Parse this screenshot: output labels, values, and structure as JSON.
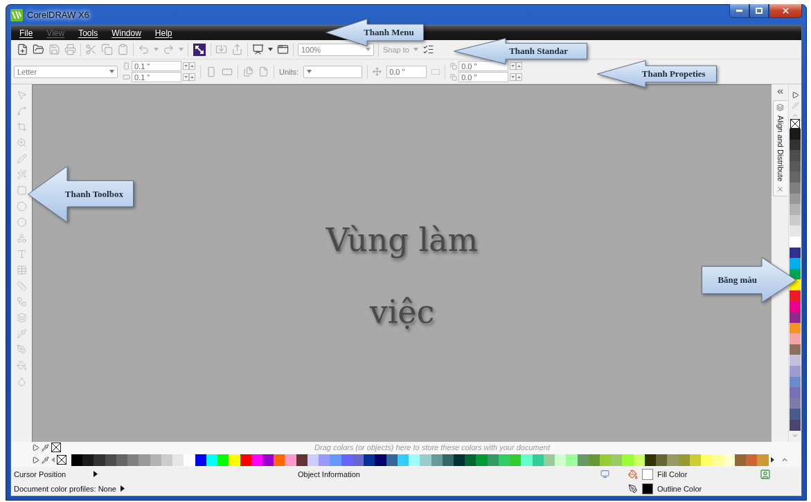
{
  "window": {
    "title": "CorelDRAW X6"
  },
  "menu": [
    {
      "label": "File",
      "disabled": false
    },
    {
      "label": "View",
      "disabled": true
    },
    {
      "label": "Tools",
      "disabled": false
    },
    {
      "label": "Window",
      "disabled": false
    },
    {
      "label": "Help",
      "disabled": false
    }
  ],
  "standard_toolbar": {
    "buttons": [
      {
        "kind": "new",
        "disabled": false
      },
      {
        "kind": "open",
        "disabled": false
      },
      {
        "kind": "save",
        "disabled": true
      },
      {
        "kind": "print",
        "disabled": true
      },
      {
        "kind": "separator"
      },
      {
        "kind": "cut",
        "disabled": true
      },
      {
        "kind": "copy",
        "disabled": true
      },
      {
        "kind": "paste",
        "disabled": true
      },
      {
        "kind": "separator"
      },
      {
        "kind": "undo",
        "disabled": true
      },
      {
        "kind": "caret",
        "disabled": true
      },
      {
        "kind": "redo",
        "disabled": true
      },
      {
        "kind": "caret",
        "disabled": true
      },
      {
        "kind": "separator"
      },
      {
        "kind": "launcher",
        "disabled": false
      },
      {
        "kind": "separator"
      },
      {
        "kind": "import",
        "disabled": true
      },
      {
        "kind": "export",
        "disabled": true
      },
      {
        "kind": "separator"
      },
      {
        "kind": "publish",
        "disabled": false
      },
      {
        "kind": "caret",
        "disabled": false
      },
      {
        "kind": "welcome",
        "disabled": false
      },
      {
        "kind": "separator"
      },
      {
        "kind": "zoom",
        "value": "100%",
        "disabled": true
      },
      {
        "kind": "separator"
      },
      {
        "kind": "snap",
        "label": "Snap to",
        "disabled": true
      },
      {
        "kind": "options",
        "disabled": false
      }
    ]
  },
  "property_bar": {
    "paper": "Letter",
    "page_dims": [
      "0.1 \"",
      "0.1 \""
    ],
    "units_label": "Units:",
    "nudge": "0.0 \"",
    "duplicate": [
      "0.0 \"",
      "0.0 \""
    ]
  },
  "toolbox": {
    "tools": [
      {
        "kind": "pick",
        "disabled": true
      },
      {
        "kind": "shape",
        "disabled": true
      },
      {
        "kind": "crop",
        "disabled": true
      },
      {
        "kind": "zoom",
        "disabled": true
      },
      {
        "kind": "freehand",
        "disabled": true
      },
      {
        "kind": "smart",
        "disabled": true
      },
      {
        "kind": "rectangle",
        "disabled": true
      },
      {
        "kind": "ellipse",
        "disabled": true
      },
      {
        "kind": "polygon",
        "disabled": true
      },
      {
        "kind": "basic_shapes",
        "disabled": true
      },
      {
        "kind": "text",
        "disabled": true
      },
      {
        "kind": "table",
        "disabled": true
      },
      {
        "kind": "dimension",
        "disabled": true
      },
      {
        "kind": "connector",
        "disabled": true
      },
      {
        "kind": "blend",
        "disabled": true
      },
      {
        "kind": "eyedropper",
        "disabled": true
      },
      {
        "kind": "outline",
        "disabled": true
      },
      {
        "kind": "fill",
        "disabled": true
      },
      {
        "kind": "interactive_fill",
        "disabled": true
      }
    ]
  },
  "canvas": {
    "text": "Vùng làm việc"
  },
  "docker": {
    "title": "Align and Distribute"
  },
  "vertical_palette": {
    "colors": [
      {
        "color": "#1a1a1a"
      },
      {
        "color": "#333333"
      },
      {
        "color": "#4d4d4d"
      },
      {
        "color": "#595959"
      },
      {
        "color": "#666666"
      },
      {
        "color": "#808080"
      },
      {
        "color": "#999999"
      },
      {
        "color": "#b3b3b3"
      },
      {
        "color": "#cccccc"
      },
      {
        "color": "#e6e6e6"
      },
      {
        "color": "#ffffff"
      },
      {
        "color": "#2e3192"
      },
      {
        "color": "#00aeef"
      },
      {
        "color": "#00a651"
      },
      {
        "color": "#fff200"
      },
      {
        "color": "#ed1c24"
      },
      {
        "color": "#ec008c"
      },
      {
        "color": "#92278f"
      },
      {
        "color": "#f7941d"
      },
      {
        "color": "#f5a3a3"
      },
      {
        "color": "#8c6e63"
      },
      {
        "color": "#c5c0e0"
      },
      {
        "color": "#9e9bd0"
      },
      {
        "color": "#6a8ccc"
      },
      {
        "color": "#7670b8"
      },
      {
        "color": "#7e7aa9"
      },
      {
        "color": "#4a5a8a"
      },
      {
        "color": "#4b4470"
      }
    ]
  },
  "document_palette": {
    "hint": "Drag colors (or objects) here to store these colors with your document"
  },
  "palette": {
    "colors": [
      {
        "color": "#000000"
      },
      {
        "color": "#1a1a1a"
      },
      {
        "color": "#333333"
      },
      {
        "color": "#4d4d4d"
      },
      {
        "color": "#666666"
      },
      {
        "color": "#808080"
      },
      {
        "color": "#999999"
      },
      {
        "color": "#b3b3b3"
      },
      {
        "color": "#cccccc"
      },
      {
        "color": "#e6e6e6"
      },
      {
        "color": "#ffffff"
      },
      {
        "color": "#0000ff"
      },
      {
        "color": "#00ffff"
      },
      {
        "color": "#00ff00"
      },
      {
        "color": "#ffff00"
      },
      {
        "color": "#ff0000"
      },
      {
        "color": "#ff00ff"
      },
      {
        "color": "#9900cc"
      },
      {
        "color": "#ff6600"
      },
      {
        "color": "#ff99cc"
      },
      {
        "color": "#663333"
      },
      {
        "color": "#ccccff"
      },
      {
        "color": "#9999ff"
      },
      {
        "color": "#6699ff"
      },
      {
        "color": "#6666ff"
      },
      {
        "color": "#6666cc"
      },
      {
        "color": "#003399"
      },
      {
        "color": "#000066"
      },
      {
        "color": "#336699"
      },
      {
        "color": "#33ccff"
      },
      {
        "color": "#99ffff"
      },
      {
        "color": "#99cccc"
      },
      {
        "color": "#669999"
      },
      {
        "color": "#336666"
      },
      {
        "color": "#003333"
      },
      {
        "color": "#006633"
      },
      {
        "color": "#009933"
      },
      {
        "color": "#339966"
      },
      {
        "color": "#33cc66"
      },
      {
        "color": "#33cc33"
      },
      {
        "color": "#66ffcc"
      },
      {
        "color": "#33cc99"
      },
      {
        "color": "#99cc99"
      },
      {
        "color": "#ccffcc"
      },
      {
        "color": "#99ff99"
      },
      {
        "color": "#669966"
      },
      {
        "color": "#669933"
      },
      {
        "color": "#99cc33"
      },
      {
        "color": "#99cc66"
      },
      {
        "color": "#99ff33"
      },
      {
        "color": "#ccff66"
      },
      {
        "color": "#333300"
      },
      {
        "color": "#666633"
      },
      {
        "color": "#999966"
      },
      {
        "color": "#999933"
      },
      {
        "color": "#cccc33"
      },
      {
        "color": "#ffff66"
      },
      {
        "color": "#ffff99"
      },
      {
        "color": "#ffffcc"
      },
      {
        "color": "#996633"
      },
      {
        "color": "#cc6633"
      },
      {
        "color": "#cc9933"
      }
    ]
  },
  "status_bar": {
    "cursor_position": "Cursor Position",
    "object_information": "Object Information",
    "color_profiles": "Document color profiles: None",
    "fill": {
      "label": "Fill Color",
      "color": "#ffffff"
    },
    "outline": {
      "label": "Outline Color",
      "color": "#000000"
    }
  },
  "callouts": [
    {
      "kind": "menu",
      "label": "Thanh Menu"
    },
    {
      "kind": "standard",
      "label": "Thanh Standar"
    },
    {
      "kind": "property",
      "label": "Thanh Propeties"
    },
    {
      "kind": "toolbox",
      "label": "Thanh Toolbox"
    },
    {
      "kind": "palette",
      "label": "Băng màu"
    }
  ]
}
